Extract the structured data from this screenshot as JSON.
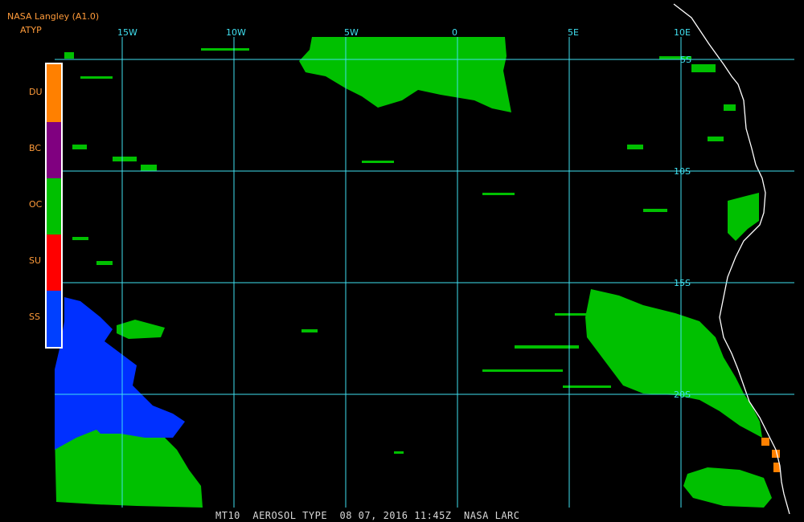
{
  "header": {
    "title": "NASA Langley (A1.0)",
    "subtitle": "ATYP"
  },
  "legend": {
    "items": [
      {
        "label": "DU",
        "color": "#ff8000"
      },
      {
        "label": "BC",
        "color": "#800080"
      },
      {
        "label": "OC",
        "color": "#00c000"
      },
      {
        "label": "SU",
        "color": "#ff0000"
      },
      {
        "label": "SS",
        "color": "#0040ff"
      }
    ]
  },
  "grid": {
    "lon_labels": [
      "15W",
      "10W",
      "5W",
      "0",
      "5E",
      "10E"
    ],
    "lat_labels": [
      "5S",
      "10S",
      "15S",
      "20S"
    ],
    "color": "#40e0f0"
  },
  "footer": {
    "text": "MT10  AEROSOL TYPE  08 07, 2016 11:45Z  NASA LARC"
  }
}
